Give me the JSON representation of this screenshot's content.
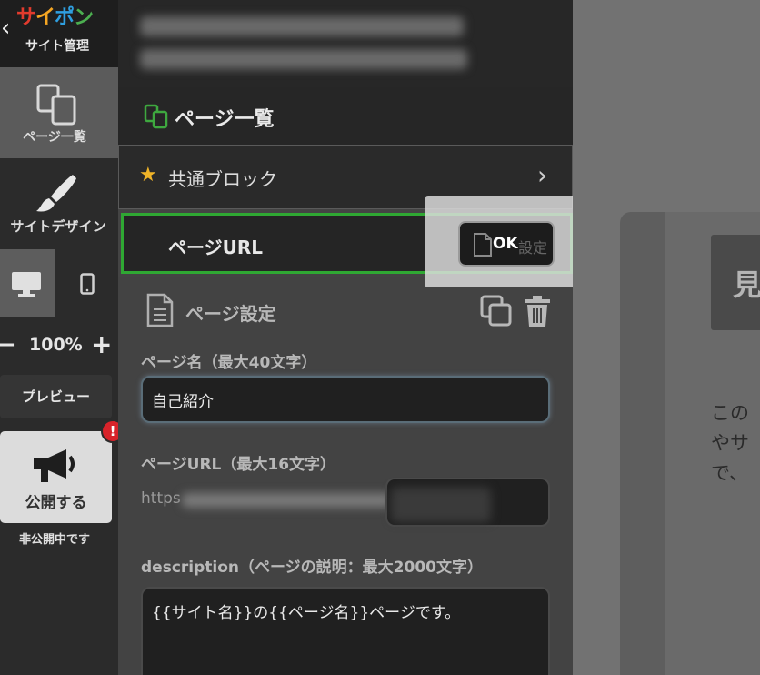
{
  "sidebar": {
    "brand": [
      "サ",
      "イ",
      "ポ",
      "ン",
      ""
    ],
    "back_icon": "chevron-left",
    "subtitle": "サイト管理",
    "pages_label": "ページ一覧",
    "design_label": "サイトデザイン",
    "zoom_minus": "−",
    "zoom_value": "100%",
    "zoom_plus": "+",
    "preview_label": "プレビュー",
    "publish_label": "公開する",
    "alert_mark": "!",
    "unpublished_note": "非公開中です"
  },
  "panel": {
    "header_title": "ページ一覧",
    "common_blocks_label": "共通ブロック",
    "chevron": "›",
    "current_page_label": "ページURL",
    "ok_label": "OK",
    "ok_ghost_text": "設定",
    "settings_title": "ページ設定",
    "fields": {
      "name_label": "ページ名（最大40文字）",
      "name_value": "自己紹介",
      "url_label": "ページURL（最大16文字）",
      "url_prefix": "https",
      "description_label": "description（ページの説明：最大2000文字）",
      "description_value": "{{サイト名}}の{{ページ名}}ページです。"
    }
  },
  "preview": {
    "heading_char": "見",
    "body_lines": [
      "この",
      "やサ",
      "で、"
    ]
  },
  "colors": {
    "accent_green": "#2fa833",
    "alert_red": "#d8232a",
    "star": "#f0b428"
  }
}
